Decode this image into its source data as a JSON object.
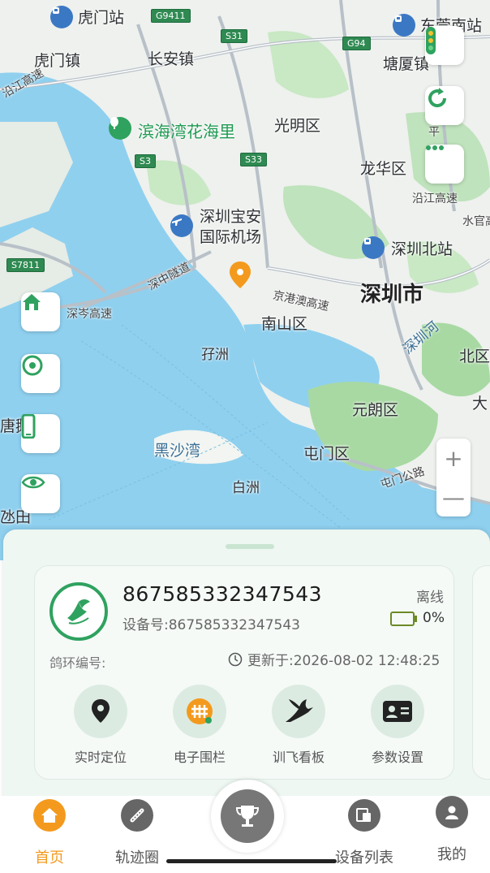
{
  "map": {
    "labels": {
      "humen_station": "虎门站",
      "humen_town": "虎门镇",
      "changan_town": "长安镇",
      "binhai_flower": "滨海湾花海里",
      "guangming": "光明区",
      "tangxia": "塘厦镇",
      "dongguan_south": "东莞南站",
      "longhua": "龙华区",
      "airport": "深圳宝安\n国际机场",
      "shenzhen_north": "深圳北站",
      "shenzhen_city": "深圳市",
      "nanshan": "南山区",
      "zaizhou": "孖洲",
      "heisha": "黑沙湾",
      "yuanlang": "元朗区",
      "tunmen": "屯门区",
      "baizhou": "白洲",
      "north_district": "北区",
      "tang_partial": "唐鹅",
      "tuotian_partial": "氹田",
      "da_partial": "大",
      "shenzhong": "深中隧道",
      "shencen": "深岑高速",
      "jinggangao": "京港澳高速",
      "yanjiang": "沿江高速",
      "shuiguan": "水官高",
      "shenzhen_river": "深圳河",
      "tunmen_road": "屯门公路",
      "pingtang": "平"
    },
    "shields": {
      "g9411": "G9411",
      "s31": "S31",
      "g94": "G94",
      "s3": "S3",
      "s33": "S33",
      "s7811": "S7811"
    },
    "zoom_in": "+",
    "zoom_out": "—"
  },
  "device": {
    "name": "867585332347543",
    "id_line": "设备号:867585332347543",
    "status": "离线",
    "battery": "0%",
    "battery_level": 0,
    "ring_label": "鸽环编号:",
    "updated": "更新于:2026-08-02 12:48:25"
  },
  "actions": [
    {
      "label": "实时定位",
      "icon": "location-pin-icon"
    },
    {
      "label": "电子围栏",
      "icon": "fence-icon"
    },
    {
      "label": "训飞看板",
      "icon": "bird-icon"
    },
    {
      "label": "参数设置",
      "icon": "id-card-icon"
    }
  ],
  "tabs": [
    {
      "label": "首页",
      "icon": "home-icon",
      "active": true
    },
    {
      "label": "轨迹圈",
      "icon": "track-icon"
    },
    {
      "label": "",
      "icon": "trophy-icon"
    },
    {
      "label": "设备列表",
      "icon": "device-list-icon"
    },
    {
      "label": "我的",
      "icon": "profile-icon"
    }
  ],
  "colors": {
    "accent": "#2fa25f",
    "tab_active": "#f39a1e",
    "panel_bg": "#eef7f2"
  }
}
